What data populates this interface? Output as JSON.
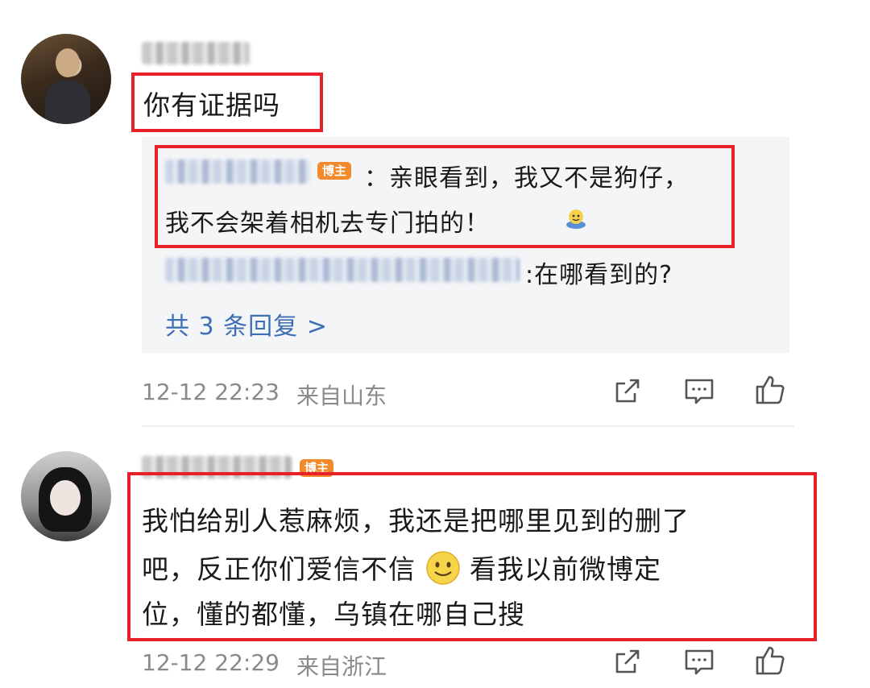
{
  "comment1": {
    "text": "你有证据吗",
    "replies": {
      "reply1": {
        "badge": "博主",
        "line1": "：亲眼看到，我又不是狗仔，",
        "line2": "我不会架着相机去专门拍的！"
      },
      "reply2": {
        "text": ":在哪看到的?"
      },
      "more": "共 3 条回复 >"
    },
    "time": "12-12 22:23",
    "location": "来自山东",
    "icons": [
      "share-icon",
      "comment-icon",
      "like-icon"
    ]
  },
  "comment2": {
    "badge": "博主",
    "line1": "我怕给别人惹麻烦，我还是把哪里见到的删了",
    "line2a": "吧，反正你们爱信不信",
    "line2b": "看我以前微博定",
    "line3": "位，懂的都懂，乌镇在哪自己搜",
    "time": "12-12 22:29",
    "location": "来自浙江",
    "icons": [
      "share-icon",
      "comment-icon",
      "like-icon"
    ]
  },
  "colors": {
    "highlight_box": "#e8202a",
    "badge": "#f08a2b",
    "reply_link": "#3c6fb4",
    "meta_text": "#8a8a8a"
  }
}
